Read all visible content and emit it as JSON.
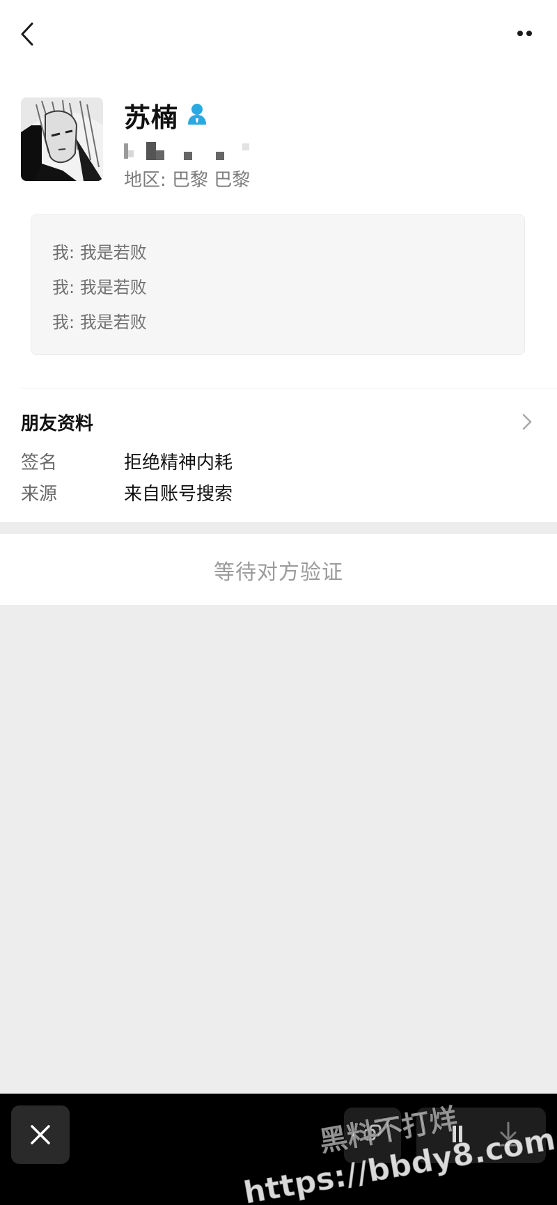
{
  "header": {
    "back_icon": "back-arrow-icon",
    "more_icon": "more-dots-icon"
  },
  "profile": {
    "name": "苏楠",
    "contact_icon": "person-icon",
    "region_label": "地区:",
    "region_value": "巴黎 巴黎"
  },
  "messages": [
    {
      "sender": "我:",
      "text": "我是若败"
    },
    {
      "sender": "我:",
      "text": "我是若败"
    },
    {
      "sender": "我:",
      "text": "我是若败"
    }
  ],
  "friend_info": {
    "title": "朋友资料",
    "rows": [
      {
        "label": "签名",
        "value": "拒绝精神内耗"
      },
      {
        "label": "来源",
        "value": "来自账号搜索"
      }
    ]
  },
  "verify": {
    "status_text": "等待对方验证"
  },
  "bottom_bar": {
    "close_icon": "close-icon",
    "download_icon": "download-icon"
  },
  "watermark": {
    "line1": "黑料不打烊",
    "line2": "https://bbdy8.com"
  },
  "colors": {
    "accent": "#2aa9e0",
    "page_background": "#ededed",
    "muted_text": "#7d7d7d"
  }
}
